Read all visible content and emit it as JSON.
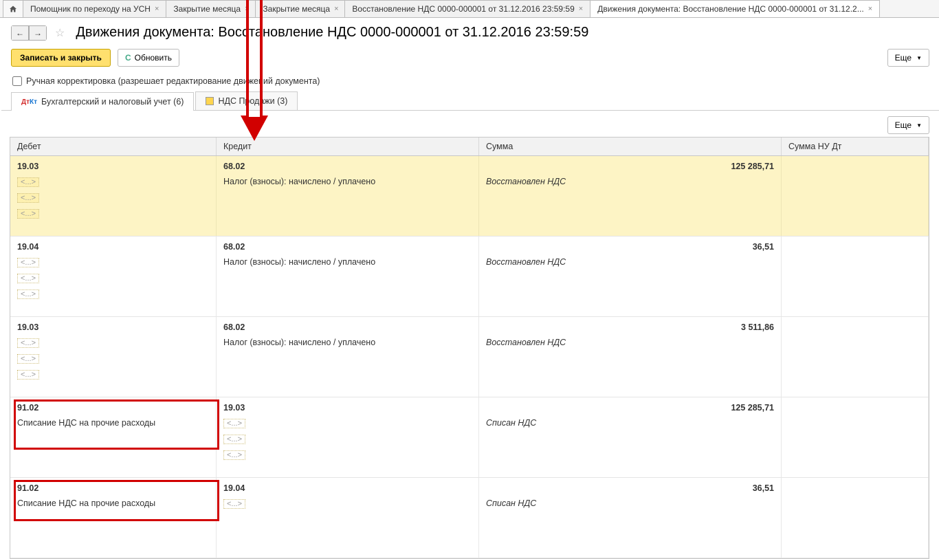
{
  "tabs": [
    {
      "label": "Помощник по переходу на УСН"
    },
    {
      "label": "Закрытие месяца"
    },
    {
      "label": "Закрытие месяца"
    },
    {
      "label": "Восстановление НДС 0000-000001 от 31.12.2016 23:59:59"
    },
    {
      "label": "Движения документа: Восстановление НДС 0000-000001 от 31.12.2..."
    }
  ],
  "page_title": "Движения документа: Восстановление НДС 0000-000001 от 31.12.2016 23:59:59",
  "toolbar": {
    "save_close": "Записать и закрыть",
    "refresh": "Обновить",
    "more": "Еще"
  },
  "checkbox_label": "Ручная корректировка (разрешает редактирование движений документа)",
  "inner_tabs": {
    "tab1": "Бухгалтерский и налоговый учет (6)",
    "tab2": "НДС Продажи (3)"
  },
  "grid": {
    "headers": {
      "debit": "Дебет",
      "credit": "Кредит",
      "sum": "Сумма",
      "nu_dt": "Сумма НУ Дт"
    },
    "rows": [
      {
        "highlight": true,
        "debit_acc": "19.03",
        "debit_sub": [
          "<...>",
          "<...>",
          "<...>"
        ],
        "credit_acc": "68.02",
        "credit_sub": [
          "Налог (взносы): начислено / уплачено"
        ],
        "sum": "125 285,71",
        "sum_note": "Восстановлен НДС"
      },
      {
        "highlight": false,
        "debit_acc": "19.04",
        "debit_sub": [
          "<...>",
          "<...>",
          "<...>"
        ],
        "credit_acc": "68.02",
        "credit_sub": [
          "Налог (взносы): начислено / уплачено"
        ],
        "sum": "36,51",
        "sum_note": "Восстановлен НДС"
      },
      {
        "highlight": false,
        "debit_acc": "19.03",
        "debit_sub": [
          "<...>",
          "<...>",
          "<...>"
        ],
        "credit_acc": "68.02",
        "credit_sub": [
          "Налог (взносы): начислено / уплачено"
        ],
        "sum": "3 511,86",
        "sum_note": "Восстановлен НДС"
      },
      {
        "highlight": false,
        "debit_acc": "91.02",
        "debit_sub": [
          "Списание НДС на прочие расходы"
        ],
        "credit_acc": "19.03",
        "credit_sub": [
          "<...>",
          "<...>",
          "<...>"
        ],
        "sum": "125 285,71",
        "sum_note": "Списан НДС"
      },
      {
        "highlight": false,
        "debit_acc": "91.02",
        "debit_sub": [
          "Списание НДС на прочие расходы"
        ],
        "credit_acc": "19.04",
        "credit_sub": [
          "<...>"
        ],
        "sum": "36,51",
        "sum_note": "Списан НДС"
      }
    ]
  }
}
